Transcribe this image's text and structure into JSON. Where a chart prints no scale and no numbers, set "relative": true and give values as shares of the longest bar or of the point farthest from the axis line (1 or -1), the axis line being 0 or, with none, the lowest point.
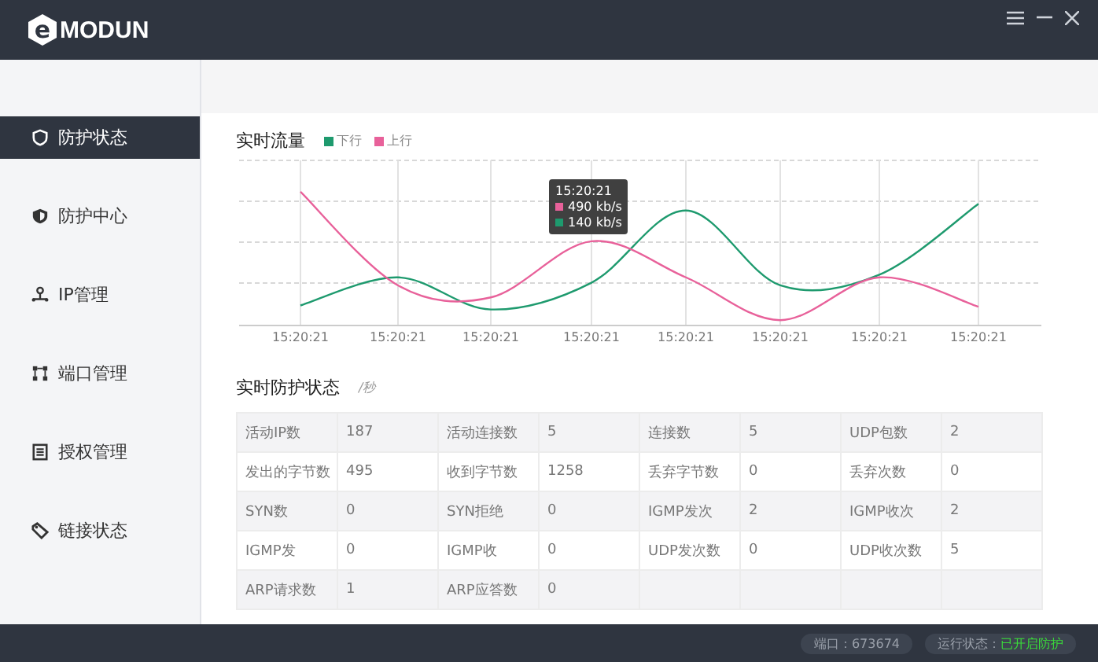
{
  "header": {
    "logo_mark": "e",
    "logo_text": "MODUN"
  },
  "sidebar": {
    "items": [
      {
        "label": "防护状态",
        "selected": true
      },
      {
        "label": "防护中心",
        "selected": false
      },
      {
        "label": "IP管理",
        "selected": false
      },
      {
        "label": "端口管理",
        "selected": false
      },
      {
        "label": "授权管理",
        "selected": false
      },
      {
        "label": "链接状态",
        "selected": false
      }
    ]
  },
  "traffic": {
    "title": "实时流量",
    "chart_data": {
      "type": "line",
      "categories": [
        "15:20:21",
        "15:20:21",
        "15:20:21",
        "15:20:21",
        "15:20:21",
        "15:20:21",
        "15:20:21",
        "15:20:21"
      ],
      "relative": true,
      "grid": true,
      "series": [
        {
          "name": "下行",
          "color": "#1e9a6e",
          "values": [
            0.15,
            0.36,
            0.12,
            0.32,
            0.86,
            0.3,
            0.38,
            0.91
          ]
        },
        {
          "name": "上行",
          "color": "#e8619a",
          "values": [
            1,
            0.3,
            0.21,
            0.63,
            0.36,
            0.04,
            0.36,
            0.14
          ]
        }
      ]
    },
    "tooltip": {
      "time": "15:20:21",
      "rows": [
        {
          "value": "490 kb/s",
          "color": "#e8619a"
        },
        {
          "value": "140 kb/s",
          "color": "#1e9a6e"
        }
      ]
    }
  },
  "stats": {
    "title": "实时防护状态",
    "unit": "/秒",
    "rows": [
      [
        "活动IP数",
        "187",
        "活动连接数",
        "5",
        "连接数",
        "5",
        "UDP包数",
        "2"
      ],
      [
        "发出的字节数",
        "495",
        "收到字节数",
        "1258",
        "丢弃字节数",
        "0",
        "丢弃次数",
        "0"
      ],
      [
        "SYN数",
        "0",
        "SYN拒绝",
        "0",
        "IGMP发次",
        "2",
        "IGMP收次",
        "2"
      ],
      [
        "IGMP发",
        "0",
        "IGMP收",
        "0",
        "UDP发次数",
        "0",
        "UDP收次数",
        "5"
      ],
      [
        "ARP请求数",
        "1",
        "ARP应答数",
        "0"
      ]
    ]
  },
  "status_bar": {
    "port": "端口：673674",
    "run_label": "运行状态：",
    "run_value": "已开启防护"
  }
}
